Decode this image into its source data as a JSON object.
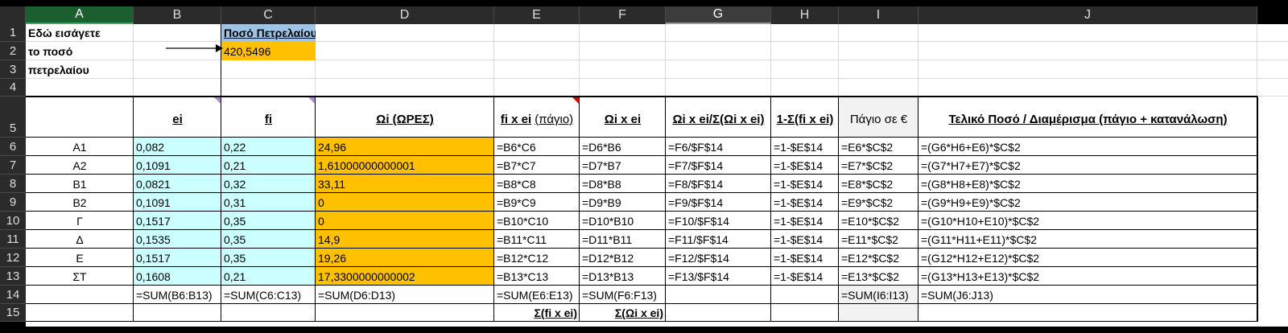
{
  "columns": [
    "A",
    "B",
    "C",
    "D",
    "E",
    "F",
    "G",
    "H",
    "I",
    "J"
  ],
  "rows": [
    "1",
    "2",
    "3",
    "4",
    "5",
    "6",
    "7",
    "8",
    "9",
    "10",
    "11",
    "12",
    "13",
    "14",
    "15"
  ],
  "notes": {
    "a1": "Εδώ εισάγετε",
    "a2": "το ποσό",
    "a3": "πετρελαίου",
    "c1": "Ποσό Πετρελαίου",
    "c2": "420,5496"
  },
  "headers": {
    "b": "ei",
    "c": "fi",
    "d": "Ωi (ΩΡΕΣ)",
    "e_main": "fi x ei",
    "e_sub": "(πάγιο)",
    "f": "Ωi x ei",
    "g": "Ωi x ei/Σ(Ωi x ei)",
    "h": "1-Σ(fi x ei)",
    "i": "Πάγιο σε €",
    "j": "Τελικό Ποσό / Διαμέρισμα (πάγιο + κατανάλωση)"
  },
  "data_rows": [
    {
      "a": "Α1",
      "b": "0,082",
      "c": "0,22",
      "d": "24,96",
      "e": "=B6*C6",
      "f": "=D6*B6",
      "g": "=F6/$F$14",
      "h": "=1-$E$14",
      "i": "=E6*$C$2",
      "j": "=(G6*H6+E6)*$C$2"
    },
    {
      "a": "Α2",
      "b": "0,1091",
      "c": "0,21",
      "d": "1,61000000000001",
      "e": "=B7*C7",
      "f": "=D7*B7",
      "g": "=F7/$F$14",
      "h": "=1-$E$14",
      "i": "=E7*$C$2",
      "j": "=(G7*H7+E7)*$C$2"
    },
    {
      "a": "Β1",
      "b": "0,0821",
      "c": "0,32",
      "d": "33,11",
      "e": "=B8*C8",
      "f": "=D8*B8",
      "g": "=F8/$F$14",
      "h": "=1-$E$14",
      "i": "=E8*$C$2",
      "j": "=(G8*H8+E8)*$C$2"
    },
    {
      "a": "Β2",
      "b": "0,1091",
      "c": "0,31",
      "d": "0",
      "e": "=B9*C9",
      "f": "=D9*B9",
      "g": "=F9/$F$14",
      "h": "=1-$E$14",
      "i": "=E9*$C$2",
      "j": "=(G9*H9+E9)*$C$2"
    },
    {
      "a": "Γ",
      "b": "0,1517",
      "c": "0,35",
      "d": "0",
      "e": "=B10*C10",
      "f": "=D10*B10",
      "g": "=F10/$F$14",
      "h": "=1-$E$14",
      "i": "=E10*$C$2",
      "j": "=(G10*H10+E10)*$C$2"
    },
    {
      "a": "Δ",
      "b": "0,1535",
      "c": "0,35",
      "d": "14,9",
      "e": "=B11*C11",
      "f": "=D11*B11",
      "g": "=F11/$F$14",
      "h": "=1-$E$14",
      "i": "=E11*$C$2",
      "j": "=(G11*H11+E11)*$C$2"
    },
    {
      "a": "Ε",
      "b": "0,1517",
      "c": "0,35",
      "d": "19,26",
      "e": "=B12*C12",
      "f": "=D12*B12",
      "g": "=F12/$F$14",
      "h": "=1-$E$14",
      "i": "=E12*$C$2",
      "j": "=(G12*H12+E12)*$C$2"
    },
    {
      "a": "ΣΤ",
      "b": "0,1608",
      "c": "0,21",
      "d": "17,3300000000002",
      "e": "=B13*C13",
      "f": "=D13*B13",
      "g": "=F13/$F$14",
      "h": "=1-$E$14",
      "i": "=E13*$C$2",
      "j": "=(G13*H13+E13)*$C$2"
    }
  ],
  "totals": {
    "b": "=SUM(B6:B13)",
    "c": "=SUM(C6:C13)",
    "d": "=SUM(D6:D13)",
    "e": "=SUM(E6:E13)",
    "f": "=SUM(F6:F13)",
    "i": "=SUM(I6:I13)",
    "j": "=SUM(J6:J13)"
  },
  "footer": {
    "e": "Σ(fi x ei)",
    "f": "Σ(Ωi x ei)"
  },
  "colors": {
    "header_band": "#2b2b2b",
    "selected_column_header": "#3c3c3c",
    "first_column_header": "#1b5e2f",
    "cyan_fill": "#ccffff",
    "orange_fill": "#ffc000",
    "blue_fill": "#9dc3e6",
    "gray_fill": "#f2f2f2"
  }
}
